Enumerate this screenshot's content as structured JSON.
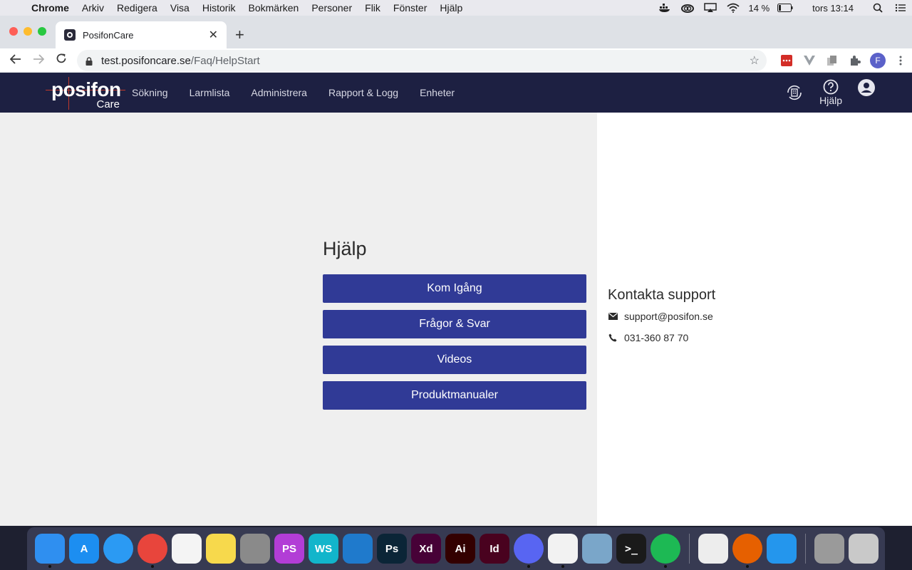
{
  "menubar": {
    "app_name": "Chrome",
    "items": [
      "Arkiv",
      "Redigera",
      "Visa",
      "Historik",
      "Bokmärken",
      "Personer",
      "Flik",
      "Fönster",
      "Hjälp"
    ],
    "battery_text": "14 %",
    "clock": "tors 13:14"
  },
  "browser": {
    "tab_title": "PosifonCare",
    "url_host": "test.posifoncare.se",
    "url_path": "/Faq/HelpStart",
    "profile_initial": "F"
  },
  "app": {
    "logo_word": "posifon",
    "logo_sub": "Care",
    "nav": [
      "Sökning",
      "Larmlista",
      "Administrera",
      "Rapport & Logg",
      "Enheter"
    ],
    "help_label": "Hjälp"
  },
  "help": {
    "title": "Hjälp",
    "buttons": [
      "Kom Igång",
      "Frågor & Svar",
      "Videos",
      "Produktmanualer"
    ]
  },
  "support": {
    "title": "Kontakta support",
    "email": "support@posifon.se",
    "phone": "031-360 87 70"
  },
  "dock": {
    "apps": [
      {
        "name": "Finder",
        "label": "",
        "color": "#2f8ff0"
      },
      {
        "name": "App Store",
        "label": "A",
        "color": "#1c8ef1"
      },
      {
        "name": "Safari",
        "label": "",
        "color": "#2b9af3"
      },
      {
        "name": "Chrome",
        "label": "",
        "color": "#e8453c"
      },
      {
        "name": "Reminders",
        "label": "",
        "color": "#f4f4f4"
      },
      {
        "name": "Notes",
        "label": "",
        "color": "#f7d94c"
      },
      {
        "name": "System Preferences",
        "label": "",
        "color": "#8a8a8a"
      },
      {
        "name": "PhpStorm",
        "label": "PS",
        "color": "#b23dd6"
      },
      {
        "name": "WebStorm",
        "label": "WS",
        "color": "#12b5cb"
      },
      {
        "name": "VS Code",
        "label": "",
        "color": "#1f7acc"
      },
      {
        "name": "Photoshop",
        "label": "Ps",
        "color": "#0b2537"
      },
      {
        "name": "Adobe XD",
        "label": "Xd",
        "color": "#470137"
      },
      {
        "name": "Illustrator",
        "label": "Ai",
        "color": "#330000"
      },
      {
        "name": "InDesign",
        "label": "Id",
        "color": "#49021f"
      },
      {
        "name": "Discord",
        "label": "",
        "color": "#5865f2"
      },
      {
        "name": "Slack",
        "label": "",
        "color": "#f2f2f2"
      },
      {
        "name": "Preview",
        "label": "",
        "color": "#7aa6c9"
      },
      {
        "name": "Terminal",
        "label": ">_",
        "color": "#1a1a1a"
      },
      {
        "name": "Spotify",
        "label": "",
        "color": "#1db954"
      },
      {
        "name": "TextEdit",
        "label": "",
        "color": "#ededed"
      },
      {
        "name": "Firefox",
        "label": "",
        "color": "#e66000"
      },
      {
        "name": "Docker",
        "label": "",
        "color": "#2496ed"
      },
      {
        "name": "Downloads",
        "label": "",
        "color": "#9a9a9a"
      },
      {
        "name": "Trash",
        "label": "",
        "color": "#c9c9c9"
      }
    ]
  }
}
